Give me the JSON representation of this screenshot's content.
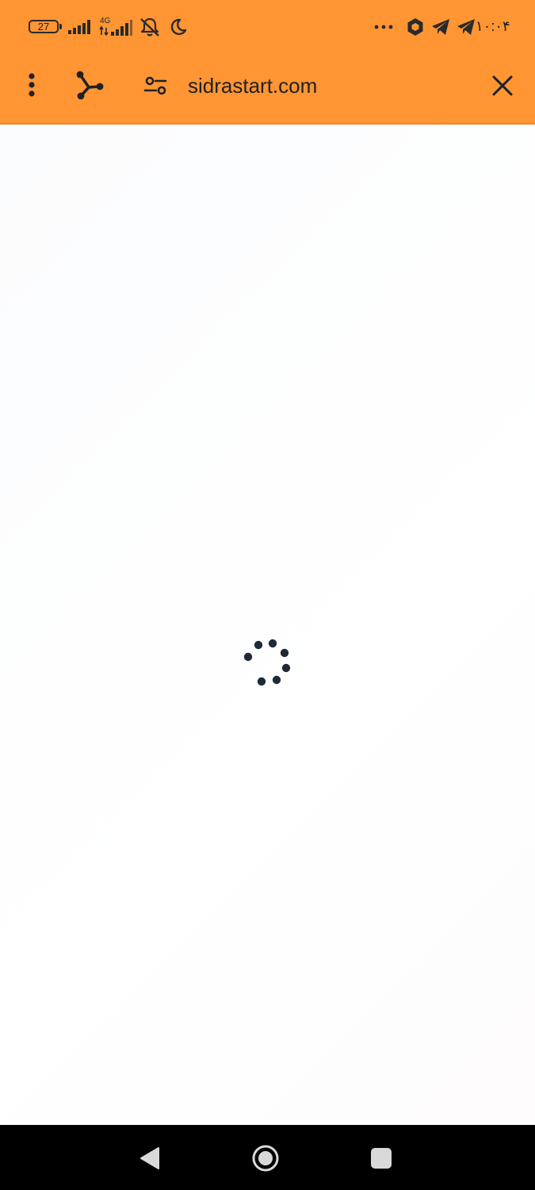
{
  "status_bar": {
    "battery_level": "27",
    "network_type": "4G",
    "time": "۱۰:۰۴",
    "icons": [
      "battery-icon",
      "signal-bars-icon",
      "signal-bars-4g-icon",
      "notifications-off-icon",
      "moon-icon",
      "more-dots-icon",
      "hexagon-app-icon",
      "telegram-icon",
      "telegram-icon"
    ]
  },
  "toolbar": {
    "url": "sidrastart.com",
    "icons": [
      "more-vert-icon",
      "share-icon",
      "site-settings-icon",
      "close-icon"
    ]
  },
  "content": {
    "state": "loading",
    "spinner_icon": "loading-spinner-icon"
  },
  "nav_bar": {
    "icons": [
      "back-triangle-icon",
      "home-circle-icon",
      "recents-square-icon"
    ]
  },
  "colors": {
    "toolbar_background": "#FF9533",
    "icon_color": "#202124",
    "spinner_color": "#1f2a37",
    "nav_background": "#000000",
    "nav_icon": "#d9d9d9"
  }
}
